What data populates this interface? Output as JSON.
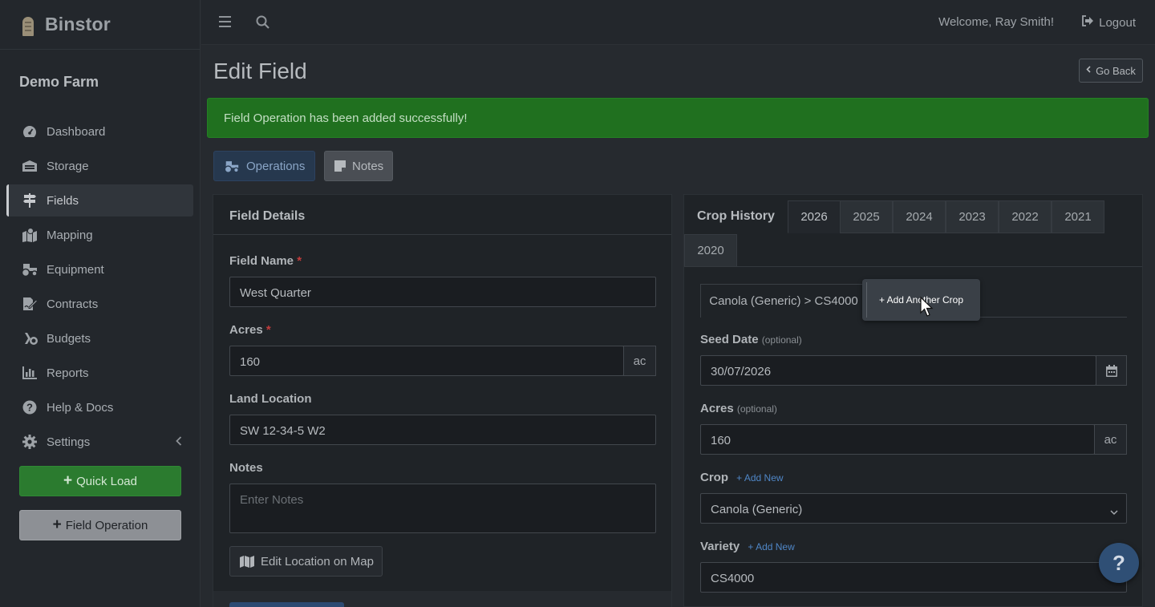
{
  "app": {
    "brand": "Binstor",
    "farm_name": "Demo Farm"
  },
  "sidebar": {
    "items": [
      {
        "label": "Dashboard",
        "icon": "gauge-icon"
      },
      {
        "label": "Storage",
        "icon": "warehouse-icon"
      },
      {
        "label": "Fields",
        "icon": "signpost-icon",
        "active": true
      },
      {
        "label": "Mapping",
        "icon": "map-marker-icon"
      },
      {
        "label": "Equipment",
        "icon": "tractor-icon"
      },
      {
        "label": "Contracts",
        "icon": "file-signature-icon"
      },
      {
        "label": "Budgets",
        "icon": "coins-icon"
      },
      {
        "label": "Reports",
        "icon": "bar-chart-icon"
      },
      {
        "label": "Help & Docs",
        "icon": "question-circle-icon"
      },
      {
        "label": "Settings",
        "icon": "gear-icon",
        "has_caret": true
      }
    ],
    "quick_load_label": "Quick Load",
    "field_operation_label": "Field Operation"
  },
  "topbar": {
    "welcome": "Welcome, Ray Smith!",
    "logout": "Logout"
  },
  "page": {
    "title": "Edit Field",
    "go_back": "Go Back",
    "alert": "Field Operation has been added successfully!",
    "tabs": {
      "operations": "Operations",
      "notes": "Notes"
    }
  },
  "field_details": {
    "heading": "Field Details",
    "field_name_label": "Field Name",
    "field_name_value": "West Quarter",
    "acres_label": "Acres",
    "acres_value": "160",
    "acres_unit": "ac",
    "land_location_label": "Land Location",
    "land_location_value": "SW 12-34-5 W2",
    "notes_label": "Notes",
    "notes_placeholder": "Enter Notes",
    "edit_map_label": "Edit Location on Map",
    "required_mark": "*"
  },
  "crop_history": {
    "heading": "Crop History",
    "years": [
      "2026",
      "2025",
      "2024",
      "2023",
      "2022",
      "2021",
      "2020"
    ],
    "active_year": "2026",
    "crop_tab": "Canola (Generic) > CS4000",
    "add_crop": "+ Add Another Crop",
    "seed_date_label": "Seed Date",
    "optional": "(optional)",
    "seed_date_value": "30/07/2026",
    "acres_label": "Acres",
    "acres_value": "160",
    "acres_unit": "ac",
    "crop_label": "Crop",
    "add_new": "+ Add New",
    "crop_value": "Canola (Generic)",
    "variety_label": "Variety",
    "variety_value": "CS4000"
  },
  "help_fab": "?"
}
